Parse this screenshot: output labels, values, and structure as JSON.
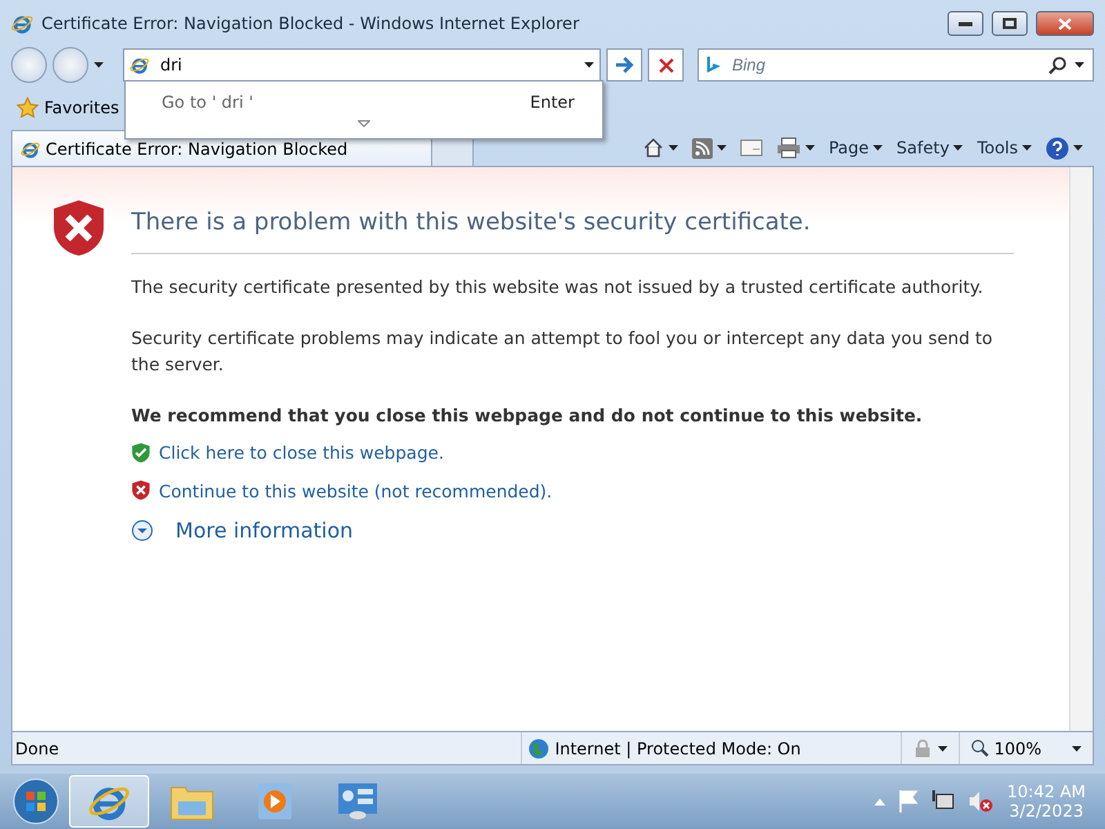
{
  "window": {
    "title": "Certificate Error: Navigation Blocked - Windows Internet Explorer"
  },
  "address": {
    "value": "dri"
  },
  "search": {
    "placeholder": "Bing"
  },
  "autocomplete": {
    "text": "Go to ' dri '",
    "hint": "Enter"
  },
  "favorites": {
    "label": "Favorites"
  },
  "tab": {
    "title": "Certificate Error: Navigation Blocked"
  },
  "commands": [
    {
      "kind": "home"
    },
    {
      "kind": "feeds"
    },
    {
      "kind": "mail"
    },
    {
      "kind": "print"
    },
    {
      "kind": "menu",
      "label": "Page"
    },
    {
      "kind": "menu",
      "label": "Safety"
    },
    {
      "kind": "menu",
      "label": "Tools"
    },
    {
      "kind": "help"
    }
  ],
  "content": {
    "heading": "There is a problem with this website's security certificate.",
    "paragraphs": [
      "The security certificate presented by this website was not issued by a trusted certificate authority.",
      "Security certificate problems may indicate an attempt to fool you or intercept any data you send to the server."
    ],
    "recommendation": "We recommend that you close this webpage and do not continue to this website.",
    "links": [
      {
        "kind": "safe",
        "label": "Click here to close this webpage."
      },
      {
        "kind": "unsafe",
        "label": "Continue to this website (not recommended)."
      }
    ],
    "more": "More information"
  },
  "status_bar": {
    "status": "Done",
    "zone": "Internet | Protected Mode: On",
    "zoom": "100%"
  },
  "taskbar": {
    "apps": [
      {
        "kind": "browser",
        "selected": true
      },
      {
        "kind": "folder",
        "selected": false
      },
      {
        "kind": "media",
        "selected": false
      },
      {
        "kind": "control",
        "selected": false
      }
    ],
    "time": "10:42 AM",
    "date": "3/2/2023"
  }
}
